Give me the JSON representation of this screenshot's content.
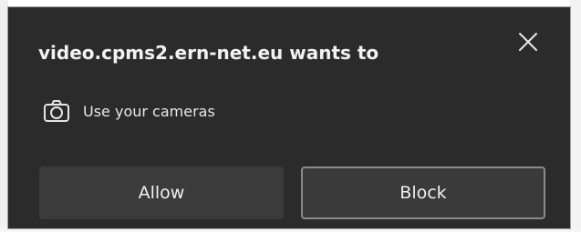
{
  "dialog": {
    "title": "video.cpms2.ern-net.eu wants to",
    "permission": {
      "icon": "camera-icon",
      "label": "Use your cameras"
    },
    "buttons": {
      "allow_label": "Allow",
      "block_label": "Block"
    },
    "close_icon": "close-icon",
    "colors": {
      "background": "#2b2b2b",
      "text": "#f2f2f2",
      "button_bg": "#3b3b3b",
      "focused_border": "#8a8a8a"
    }
  }
}
